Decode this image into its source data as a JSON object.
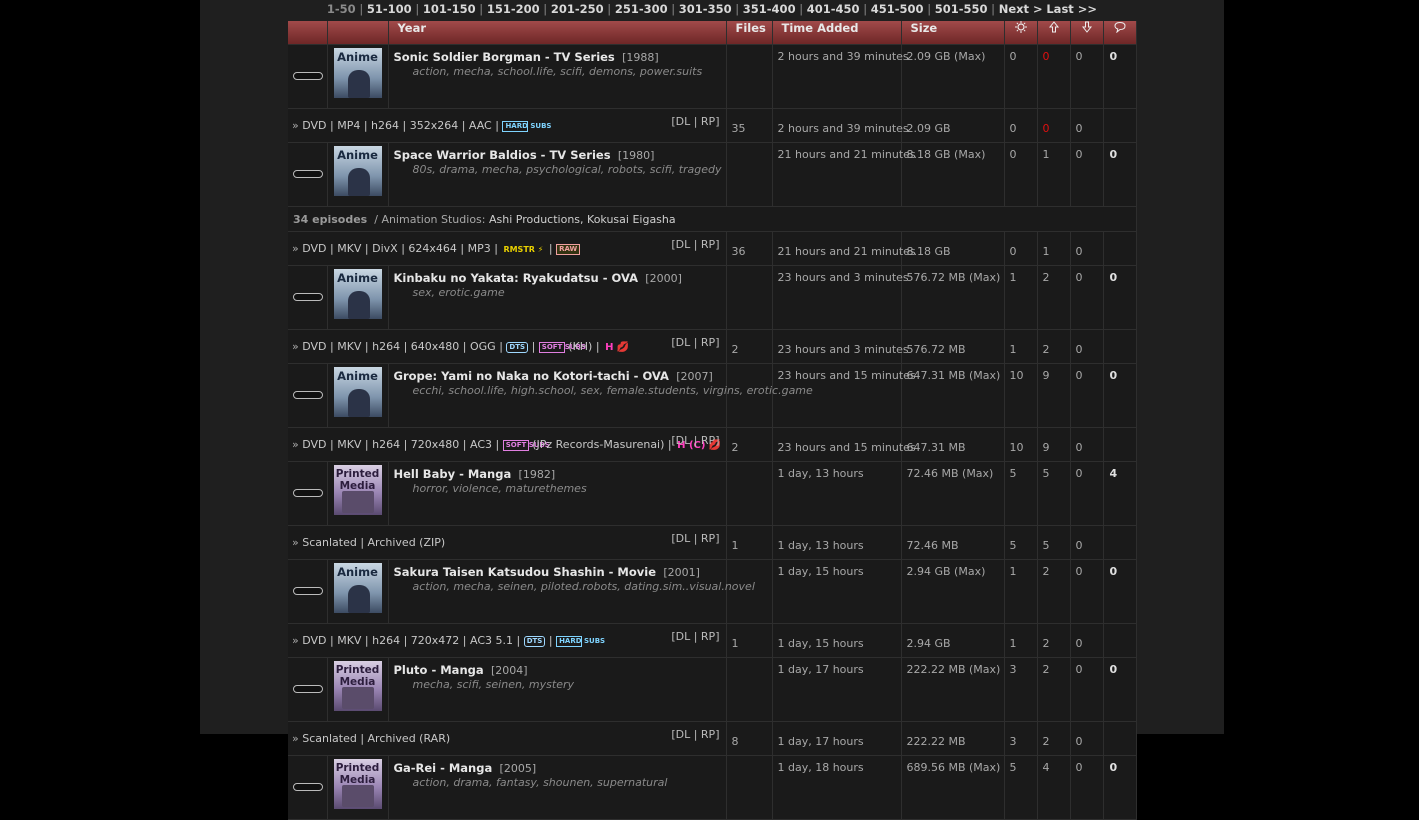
{
  "pager": {
    "current": "1-50",
    "links": [
      "51-100",
      "101-150",
      "151-200",
      "201-250",
      "251-300",
      "301-350",
      "351-400",
      "401-450",
      "451-500",
      "501-550"
    ],
    "next": "Next >",
    "last": "Last >>"
  },
  "header": {
    "year": "Year",
    "files": "Files",
    "time_added": "Time Added",
    "size": "Size",
    "seeders_icon": "sun-icon",
    "up_icon": "arrow-up-icon",
    "down_icon": "arrow-down-icon",
    "comments_icon": "speech-bubble-icon"
  },
  "series": [
    {
      "thumb": "Anime",
      "title": "Sonic Soldier Borgman - TV Series",
      "year": "[1988]",
      "tags": "action, mecha, school.life, scifi, demons, power.suits",
      "time": "2 hours and 39 minutes",
      "size": "2.09 GB (Max)",
      "seed": "0",
      "leech": "0",
      "snatch": "0",
      "comments": "0",
      "leech_red": true,
      "torrent": {
        "desc": "DVD | MP4 | h264 | 352x264 | AAC |",
        "badges": [
          "HARD SUBS"
        ],
        "links": "[DL | RP]",
        "files": "35",
        "time": "2 hours and 39 minutes",
        "size": "2.09 GB",
        "seed": "0",
        "leech": "0",
        "snatch": "0"
      }
    },
    {
      "thumb": "Anime",
      "title": "Space Warrior Baldios - TV Series",
      "year": "[1980]",
      "tags": "80s, drama, mecha, psychological, robots, scifi, tragedy",
      "time": "21 hours and 21 minutes",
      "size": "8.18 GB (Max)",
      "seed": "0",
      "leech": "1",
      "snatch": "0",
      "comments": "0",
      "info": {
        "episodes": "34 episodes",
        "studios_label": "Animation Studios:",
        "studios": "Ashi Productions, Kokusai Eigasha"
      },
      "torrent": {
        "desc": "DVD | MKV | DivX | 624x464 | MP3 |",
        "badges": [
          "RMSTR ⚡",
          "|",
          "RAW"
        ],
        "links": "[DL | RP]",
        "files": "36",
        "time": "21 hours and 21 minutes",
        "size": "8.18 GB",
        "seed": "0",
        "leech": "1",
        "snatch": "0"
      }
    },
    {
      "thumb": "Anime",
      "title": "Kinbaku no Yakata: Ryakudatsu - OVA",
      "year": "[2000]",
      "tags": "sex, erotic.game",
      "time": "23 hours and 3 minutes",
      "size": "576.72 MB (Max)",
      "seed": "1",
      "leech": "2",
      "snatch": "0",
      "comments": "0",
      "torrent": {
        "desc": "DVD | MKV | h264 | 640x480 | OGG |",
        "badges": [
          "DTS",
          "|",
          "SOFT SUBS",
          "(KH) |",
          "H 💋"
        ],
        "links": "[DL | RP]",
        "files": "2",
        "time": "23 hours and 3 minutes",
        "size": "576.72 MB",
        "seed": "1",
        "leech": "2",
        "snatch": "0"
      }
    },
    {
      "thumb": "Anime",
      "title": "Grope: Yami no Naka no Kotori-tachi - OVA",
      "year": "[2007]",
      "tags": "ecchi, school.life, high.school, sex, female.students, virgins, erotic.game",
      "time": "23 hours and 15 minutes",
      "size": "647.31 MB (Max)",
      "seed": "10",
      "leech": "9",
      "snatch": "0",
      "comments": "0",
      "torrent": {
        "desc": "DVD | MKV | h264 | 720x480 | AC3 |",
        "badges": [
          "SOFT SUBS",
          "(JPz Records-Masurenai) |",
          "H (C) 💋"
        ],
        "links": "[DL | RP]",
        "files": "2",
        "time": "23 hours and 15 minutes",
        "size": "647.31 MB",
        "seed": "10",
        "leech": "9",
        "snatch": "0"
      }
    },
    {
      "thumb": "Printed Media",
      "title": "Hell Baby - Manga",
      "year": "[1982]",
      "tags": "horror, violence, maturethemes",
      "time": "1 day, 13 hours",
      "size": "72.46 MB (Max)",
      "seed": "5",
      "leech": "5",
      "snatch": "0",
      "comments": "4",
      "torrent": {
        "desc": "Scanlated | Archived (ZIP)",
        "badges": [],
        "links": "[DL | RP]",
        "files": "1",
        "time": "1 day, 13 hours",
        "size": "72.46 MB",
        "seed": "5",
        "leech": "5",
        "snatch": "0"
      }
    },
    {
      "thumb": "Anime",
      "title": "Sakura Taisen Katsudou Shashin - Movie",
      "year": "[2001]",
      "tags": "action, mecha, seinen, piloted.robots, dating.sim..visual.novel",
      "time": "1 day, 15 hours",
      "size": "2.94 GB (Max)",
      "seed": "1",
      "leech": "2",
      "snatch": "0",
      "comments": "0",
      "torrent": {
        "desc": "DVD | MKV | h264 | 720x472 | AC3 5.1 |",
        "badges": [
          "DTS",
          "|",
          "HARD SUBS"
        ],
        "links": "[DL | RP]",
        "files": "1",
        "time": "1 day, 15 hours",
        "size": "2.94 GB",
        "seed": "1",
        "leech": "2",
        "snatch": "0"
      }
    },
    {
      "thumb": "Printed Media",
      "title": "Pluto - Manga",
      "year": "[2004]",
      "tags": "mecha, scifi, seinen, mystery",
      "time": "1 day, 17 hours",
      "size": "222.22 MB (Max)",
      "seed": "3",
      "leech": "2",
      "snatch": "0",
      "comments": "0",
      "torrent": {
        "desc": "Scanlated | Archived (RAR)",
        "badges": [],
        "links": "[DL | RP]",
        "files": "8",
        "time": "1 day, 17 hours",
        "size": "222.22 MB",
        "seed": "3",
        "leech": "2",
        "snatch": "0"
      }
    },
    {
      "thumb": "Printed Media",
      "title": "Ga-Rei - Manga",
      "year": "[2005]",
      "tags": "action, drama, fantasy, shounen, supernatural",
      "time": "1 day, 18 hours",
      "size": "689.56 MB (Max)",
      "seed": "5",
      "leech": "4",
      "snatch": "0",
      "comments": "0"
    }
  ]
}
